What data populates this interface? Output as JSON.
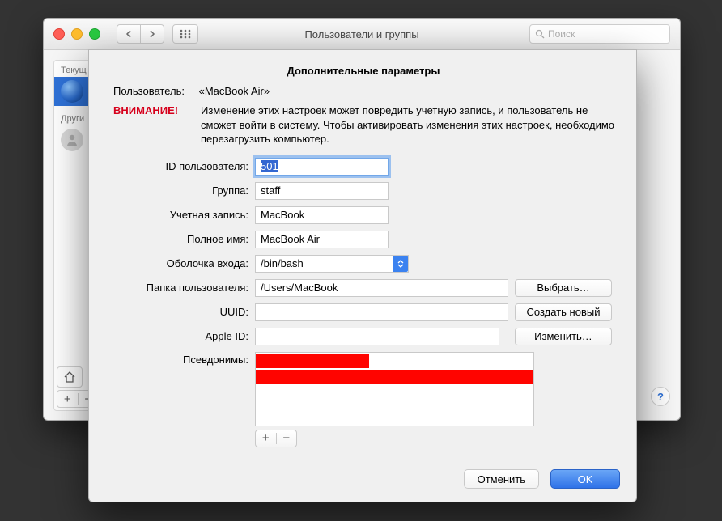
{
  "parent": {
    "title": "Пользователи и группы",
    "search_placeholder": "Поиск",
    "sidebar": {
      "section_current": "Текущ",
      "section_other": "Други",
      "current_user": "",
      "other_user": ""
    }
  },
  "sheet": {
    "title": "Дополнительные параметры",
    "user_label": "Пользователь:",
    "user_value": "«MacBook Air»",
    "warning_label": "ВНИМАНИЕ!",
    "warning_text": "Изменение этих настроек может повредить учетную запись, и пользователь не сможет войти в систему. Чтобы активировать изменения этих настроек, необходимо перезагрузить компьютер.",
    "fields": {
      "user_id_label": "ID пользователя:",
      "user_id_value": "501",
      "group_label": "Группа:",
      "group_value": "staff",
      "account_label": "Учетная запись:",
      "account_value": "MacBook",
      "fullname_label": "Полное имя:",
      "fullname_value": "MacBook Air",
      "shell_label": "Оболочка входа:",
      "shell_value": "/bin/bash",
      "home_label": "Папка пользователя:",
      "home_value": "/Users/MacBook",
      "uuid_label": "UUID:",
      "appleid_label": "Apple ID:",
      "aliases_label": "Псевдонимы:"
    },
    "buttons": {
      "choose": "Выбрать…",
      "create_new": "Создать новый",
      "change": "Изменить…",
      "cancel": "Отменить",
      "ok": "OK",
      "plus": "+",
      "minus": "−"
    }
  }
}
